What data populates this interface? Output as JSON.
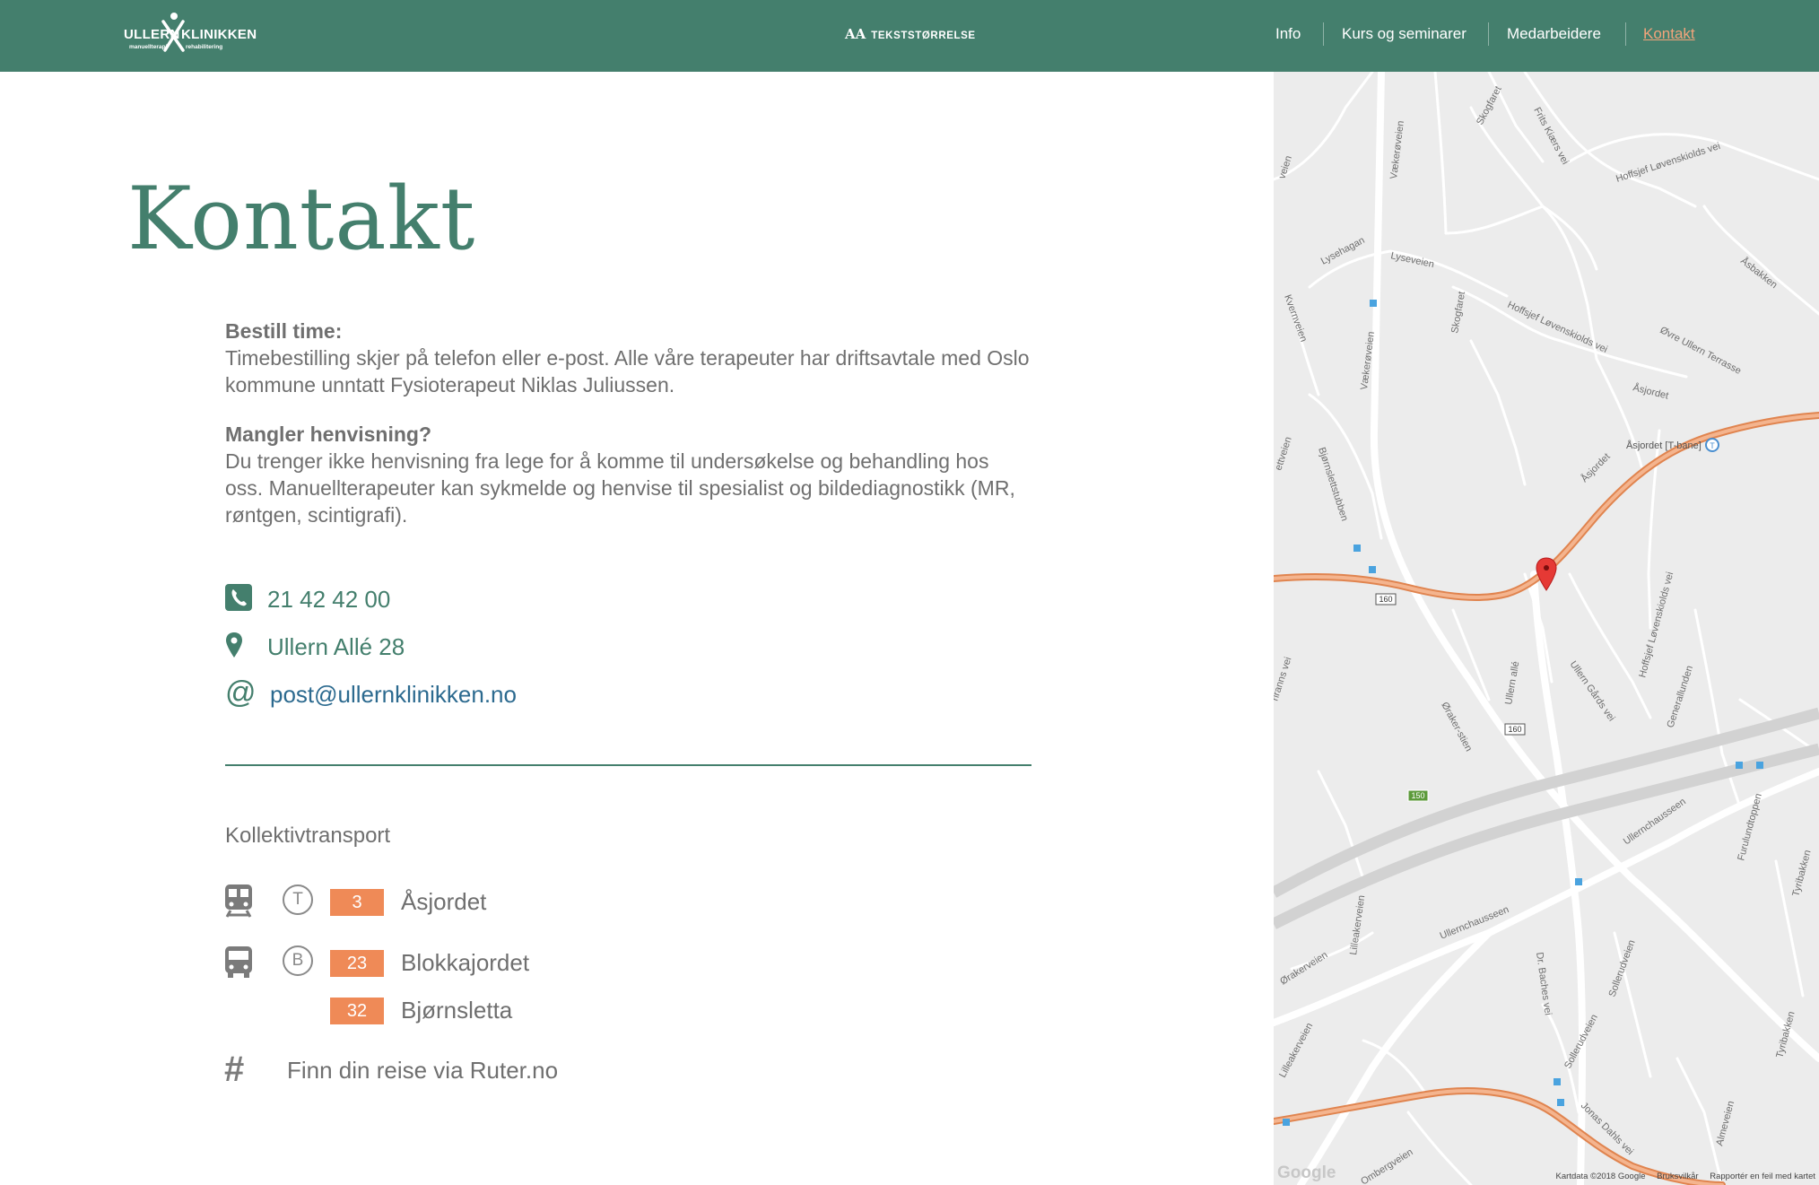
{
  "header": {
    "logo": {
      "word_left": "ULLERN",
      "word_right": "KLINIKKEN",
      "sub_left": "manuellterapi",
      "sub_right": "rehabilitering"
    },
    "text_size_prefix": "AA",
    "text_size_label": "TEKSTSTØRRELSE",
    "nav": [
      {
        "label": "Info"
      },
      {
        "label": "Kurs og seminarer"
      },
      {
        "label": "Medarbeidere"
      },
      {
        "label": "Kontakt",
        "active": true
      }
    ]
  },
  "main": {
    "title": "Kontakt",
    "booking": {
      "heading": "Bestill time:",
      "text": "Timebestilling skjer på telefon eller e-post. Alle våre terapeuter har driftsavtale med Oslo kommune unntatt Fysioterapeut Niklas Juliussen."
    },
    "referral": {
      "heading": "Mangler henvisning?",
      "text": "Du trenger ikke henvisning fra lege for å komme til undersøkelse og behandling hos oss. Manuellterapeuter kan sykmelde og henvise til spesialist og bildediagnostikk (MR, røntgen, scintigrafi)."
    },
    "contact": {
      "phone": "21 42 42 00",
      "address": "Ullern Allé 28",
      "email": "post@ullernklinikken.no"
    },
    "transport": {
      "heading": "Kollektivtransport",
      "metro": {
        "letter": "T",
        "lines": [
          {
            "number": "3",
            "stop": "Åsjordet"
          }
        ]
      },
      "bus": {
        "letter": "B",
        "lines": [
          {
            "number": "23",
            "stop": "Blokkajordet"
          },
          {
            "number": "32",
            "stop": "Bjørnsletta"
          }
        ]
      },
      "ruter_link": "Finn din reise via Ruter.no"
    }
  },
  "map": {
    "streets": {
      "vaekeroveien_top": "Vækerøveien",
      "vaekeroveien_mid": "Vækerøveien",
      "skogfaret_top": "Skogfaret",
      "skogfaret_mid": "Skogfaret",
      "frits_kiaers_vei": "Frits Kiærs vei",
      "hoffsjef_top": "Hoffsjef Løvenskiolds vei",
      "hoffsjef_mid": "Hoffsjef Løvenskiolds vei",
      "hoffsjef_low": "Hoffsjef Løvenskiolds vei",
      "lysehagan": "Lysehagan",
      "lyseveien": "Lyseveien",
      "asbakken": "Åsbakken",
      "ovre_ullern_terrasse": "Øvre Ullern Terrasse",
      "kvernveien": "Kvernveien",
      "asjordet_road": "Åsjordet",
      "asjordet_road2": "Åsjordet",
      "asjordet_tbane": "Åsjordet [T-bane]",
      "bjornslettstubben": "Bjørnslettstubben",
      "ullern_alle": "Ullern allé",
      "ullern_gards_vei": "Ullern Gårds vei",
      "generallunden": "Generallunden",
      "orakerstien": "Øraker-stien",
      "ullernchausseen_1": "Ullernchausseen",
      "ullernchausseen_2": "Ullernchausseen",
      "furulundtoppen": "Furulundtoppen",
      "tyribakken_1": "Tyribakken",
      "tyribakken_2": "Tyribakken",
      "lilleakerveien_1": "Lilleakerveien",
      "lilleakerveien_2": "Lilleakerveien",
      "orakerveien": "Ørakerveien",
      "dr_baches_vei": "Dr. Baches vei",
      "sollerudveien_1": "Sollerudveien",
      "sollerudveien_2": "Sollerudveien",
      "jonas_dahls_vei": "Jonas Dahls vei",
      "almeveien": "Almeveien",
      "ombergveien": "Ombergveien",
      "vei_left": "veien",
      "vei_left2": "ettveien",
      "vei_left3": "riranns vei"
    },
    "route_160_a": "160",
    "route_160_b": "160",
    "route_150": "150",
    "metro_marker": "T",
    "google": "Google",
    "footer": {
      "data": "Kartdata ©2018 Google",
      "terms": "Bruksvilkår",
      "report": "Rapportér en feil med kartet"
    },
    "colors": {
      "road_major": "#f0a070",
      "road_major_edge": "#e0844f",
      "railway": "#d2d2d2",
      "background": "#ececec",
      "marker": "#e53935"
    }
  },
  "theme": {
    "green": "#447f6d",
    "accent": "#ef8a57",
    "link": "#2c6a8f",
    "text": "#6f6f6f"
  }
}
